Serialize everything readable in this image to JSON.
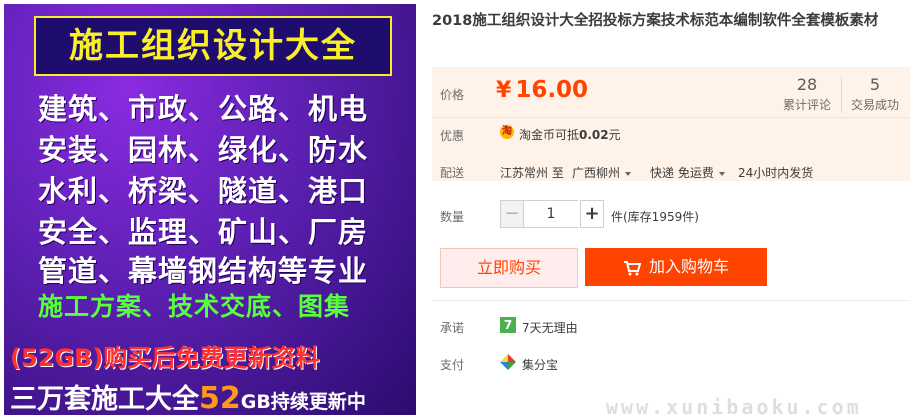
{
  "image": {
    "title": "施工组织设计大全",
    "lines": [
      "建筑、市政、公路、机电",
      "安装、园林、绿化、防水",
      "水利、桥梁、隧道、港口",
      "安全、监理、矿山、厂房",
      "管道、幕墙钢结构等专业"
    ],
    "green_line": "施工方案、技术交底、图集",
    "red_line": "(52GB)购买后免费更新资料",
    "bottom_a": "三万套施工大全",
    "bottom_b": "52",
    "bottom_c": "GB持续更新中"
  },
  "product": {
    "title": "2018施工组织设计大全招投标方案技术标范本编制软件全套模板素材"
  },
  "price": {
    "label": "价格",
    "currency": "¥",
    "value": "16.00",
    "reviews_count": "28",
    "reviews_label": "累计评论",
    "sales_count": "5",
    "sales_label": "交易成功"
  },
  "promo": {
    "label": "优惠",
    "icon_char": "淘",
    "text_a": "淘金币可抵",
    "text_b": "0.02",
    "text_c": "元"
  },
  "delivery": {
    "label": "配送",
    "from": "江苏常州 至",
    "to": "广西柳州",
    "shipping": "快递 免运费",
    "dispatch": "24小时内发货"
  },
  "quantity": {
    "label": "数量",
    "value": "1",
    "minus": "−",
    "plus": "+",
    "stock": "件(库存1959件)"
  },
  "actions": {
    "buy_now": "立即购买",
    "add_to_cart": "加入购物车"
  },
  "promise": {
    "label": "承诺",
    "icon_char": "7",
    "text": "7天无理由"
  },
  "payment": {
    "label": "支付",
    "text": "集分宝"
  },
  "watermark": "www.xunibaoku.com"
}
